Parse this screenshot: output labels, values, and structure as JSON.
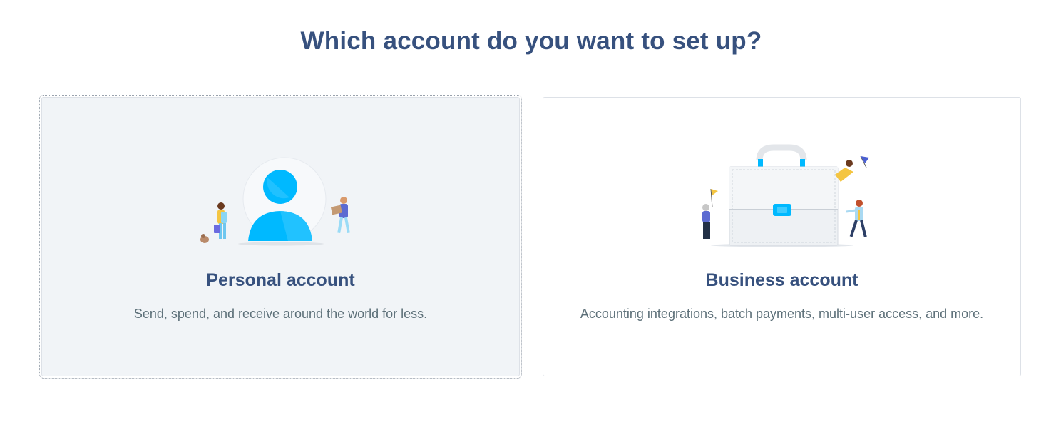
{
  "heading": "Which account do you want to set up?",
  "accent_color": "#00b9ff",
  "title_color": "#37517e",
  "text_color": "#5d7079",
  "cards": [
    {
      "id": "personal",
      "title": "Personal account",
      "description": "Send, spend, and receive around the world for less.",
      "selected": true,
      "illustration_icon": "person-avatar-icon"
    },
    {
      "id": "business",
      "title": "Business account",
      "description": "Accounting integrations, batch payments, multi-user access, and more.",
      "selected": false,
      "illustration_icon": "briefcase-icon"
    }
  ]
}
